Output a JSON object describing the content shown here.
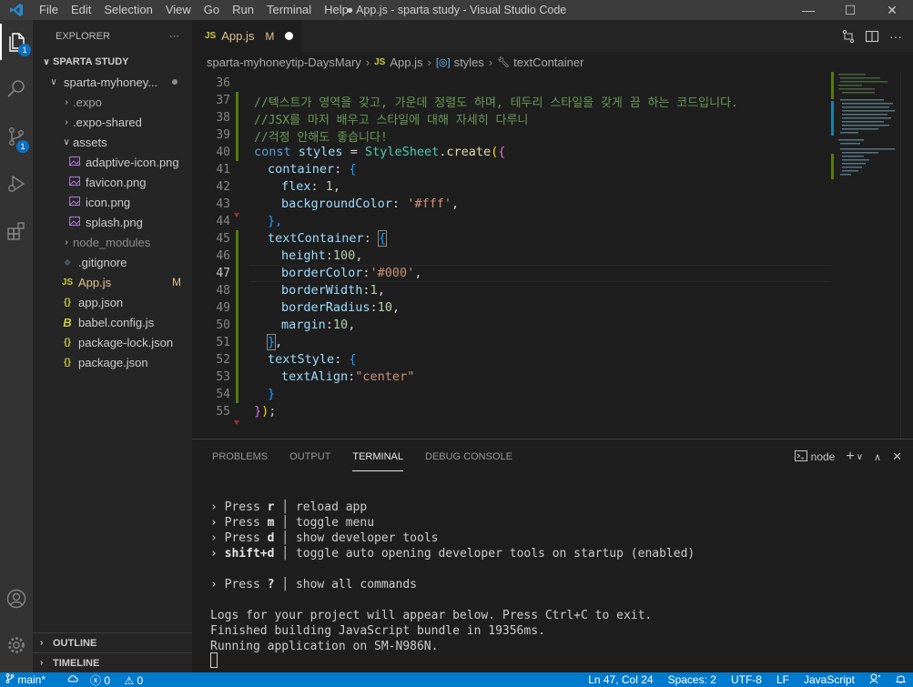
{
  "titlebar": {
    "menus": [
      "File",
      "Edit",
      "Selection",
      "View",
      "Go",
      "Run",
      "Terminal",
      "Help"
    ],
    "window_title": "● App.js - sparta study - Visual Studio Code",
    "minimize": "—",
    "maximize": "☐",
    "close": "✕"
  },
  "activitybar": {
    "explorer_badge": "1",
    "scm_badge": "1"
  },
  "sidebar": {
    "header": "EXPLORER",
    "more": "···",
    "root": "SPARTA STUDY",
    "project": "sparta-myhoney...",
    "items": [
      {
        "label": ".expo",
        "type": "folder"
      },
      {
        "label": ".expo-shared",
        "type": "folder"
      },
      {
        "label": "assets",
        "type": "folder-open"
      },
      {
        "label": "adaptive-icon.png",
        "type": "image"
      },
      {
        "label": "favicon.png",
        "type": "image"
      },
      {
        "label": "icon.png",
        "type": "image"
      },
      {
        "label": "splash.png",
        "type": "image"
      },
      {
        "label": "node_modules",
        "type": "folder"
      },
      {
        "label": ".gitignore",
        "type": "git"
      },
      {
        "label": "App.js",
        "type": "js",
        "flag": "M"
      },
      {
        "label": "app.json",
        "type": "json"
      },
      {
        "label": "babel.config.js",
        "type": "babel"
      },
      {
        "label": "package-lock.json",
        "type": "json"
      },
      {
        "label": "package.json",
        "type": "json"
      }
    ],
    "outline": "OUTLINE",
    "timeline": "TIMELINE"
  },
  "tab": {
    "icon": "JS",
    "name": "App.js",
    "flag": "M"
  },
  "breadcrumb": {
    "folder": "sparta-myhoneytip-DaysMary",
    "file_icon": "JS",
    "file": "App.js",
    "symbol1": "styles",
    "symbol2": "textContainer"
  },
  "editor": {
    "line_numbers": [
      "36",
      "37",
      "38",
      "39",
      "40",
      "41",
      "42",
      "43",
      "44",
      "45",
      "46",
      "47",
      "48",
      "49",
      "50",
      "51",
      "52",
      "53",
      "54",
      "55"
    ],
    "current_line": "47",
    "line37": "//텍스트가 영역을 갖고, 가운데 정렬도 하며, 테두리 스타일을 갖게 끔 하는 코드입니다.",
    "line38": "//JSX를 마저 배우고 스타일에 대해 자세히 다루니",
    "line39": "//걱정 안해도 좋습니다!",
    "kw_const": "const",
    "var_styles": "styles",
    "eq": " = ",
    "cls_stylesheet": "StyleSheet",
    "dot": ".",
    "fn_create": "create",
    "open_paren": "(",
    "open_brace": "{",
    "close_brace": "}",
    "close_brace_comma": "},",
    "close_all": "});",
    "prop_container": "container",
    "prop_flex": "flex",
    "val_flex": "1",
    "prop_bg": "backgroundColor",
    "val_bg": "'#fff'",
    "prop_textcontainer": "textContainer",
    "prop_height": "height",
    "val_height": "100",
    "prop_bordercolor": "borderColor",
    "val_bordercolor": "'#000'",
    "prop_borderwidth": "borderWidth",
    "val_borderwidth": "1",
    "prop_borderradius": "borderRadius",
    "val_borderradius": "10",
    "prop_margin": "margin",
    "val_margin": "10",
    "prop_textstyle": "textStyle",
    "prop_textalign": "textAlign",
    "val_textalign": "\"center\"",
    "colon_space": ": ",
    "colon": ":",
    "comma": ","
  },
  "panel": {
    "tabs": [
      "PROBLEMS",
      "OUTPUT",
      "TERMINAL",
      "DEBUG CONSOLE"
    ],
    "active_tab": "TERMINAL",
    "shell": "node",
    "add": "+",
    "dropdown": "∨",
    "maximize": "∧",
    "close": "✕",
    "terminal": {
      "press": "Press",
      "lines": [
        {
          "key": "r",
          "desc": "reload app"
        },
        {
          "key": "m",
          "desc": "toggle menu"
        },
        {
          "key": "d",
          "desc": "show developer tools"
        },
        {
          "key": "shift+d",
          "desc": "toggle auto opening developer tools on startup (enabled)"
        }
      ],
      "help_key": "?",
      "help_desc": "show all commands",
      "logs": "Logs for your project will appear below. Press Ctrl+C to exit.",
      "finished": "Finished building JavaScript bundle in 19356ms.",
      "running": "Running application on SM-N986N."
    }
  },
  "statusbar": {
    "branch": "main*",
    "errors": "0",
    "warnings": "0",
    "position": "Ln 47, Col 24",
    "spaces": "Spaces: 2",
    "encoding": "UTF-8",
    "eol": "LF",
    "language": "JavaScript"
  },
  "colors": {
    "accent": "#007acc",
    "modified": "#e2c08d",
    "badge": "#0e70c0"
  }
}
